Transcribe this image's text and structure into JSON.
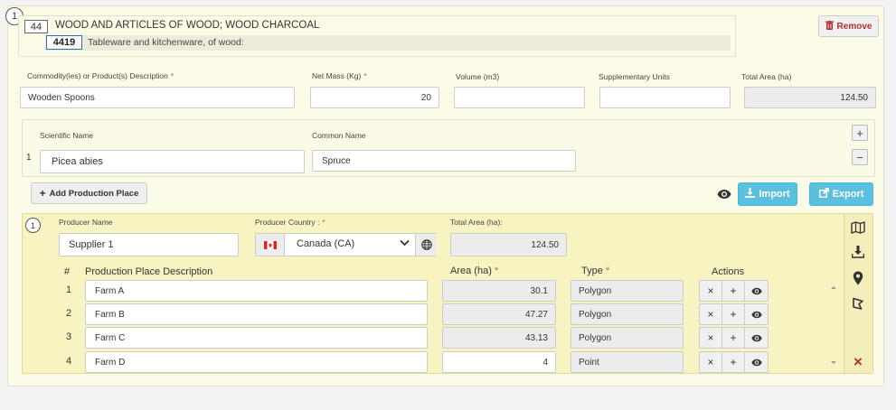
{
  "item_number": "1",
  "hs": {
    "chapter_code": "44",
    "chapter_desc": "WOOD AND ARTICLES OF WOOD; WOOD CHARCOAL",
    "heading_code": "4419",
    "heading_desc": "Tableware and kitchenware, of wood:"
  },
  "remove_label": "Remove",
  "commodity": {
    "desc_label": "Commodity(ies) or Product(s) Description",
    "desc_value": "Wooden Spoons",
    "mass_label": "Net Mass (Kg)",
    "mass_value": "20",
    "volume_label": "Volume (m3)",
    "volume_value": "",
    "supp_label": "Supplementary Units",
    "supp_value": "",
    "area_label": "Total Area (ha)",
    "area_value": "124.50",
    "required_mark": "*"
  },
  "species": {
    "sci_label": "Scientific Name",
    "common_label": "Common Name",
    "rows": [
      {
        "num": "1",
        "scientific": "Picea abies",
        "common": "Spruce"
      }
    ],
    "add_symbol": "+",
    "remove_symbol": "−"
  },
  "toolbar": {
    "add_place_label": "Add Production Place",
    "import_label": "Import",
    "export_label": "Export"
  },
  "producer": {
    "number": "1",
    "name_label": "Producer Name",
    "name_value": "Supplier 1",
    "country_label": "Producer Country :",
    "country_value": "Canada (CA)",
    "total_area_label": "Total Area (ha):",
    "total_area_value": "124.50",
    "required_mark": "*",
    "table": {
      "headers": {
        "num": "#",
        "desc": "Production Place Description",
        "area": "Area (ha)",
        "type": "Type",
        "actions": "Actions"
      },
      "rows": [
        {
          "num": "1",
          "desc": "Farm A",
          "area": "30.1",
          "type": "Polygon"
        },
        {
          "num": "2",
          "desc": "Farm B",
          "area": "47.27",
          "type": "Polygon"
        },
        {
          "num": "3",
          "desc": "Farm C",
          "area": "43.13",
          "type": "Polygon"
        },
        {
          "num": "4",
          "desc": "Farm D",
          "area": "4",
          "type": "Point"
        }
      ],
      "action_symbols": {
        "delete": "×",
        "add": "+"
      }
    },
    "delete_symbol": "×"
  },
  "colors": {
    "accent_blue": "#5bc0de",
    "danger": "#b03030",
    "panel_yellow": "#f8f4c2"
  }
}
